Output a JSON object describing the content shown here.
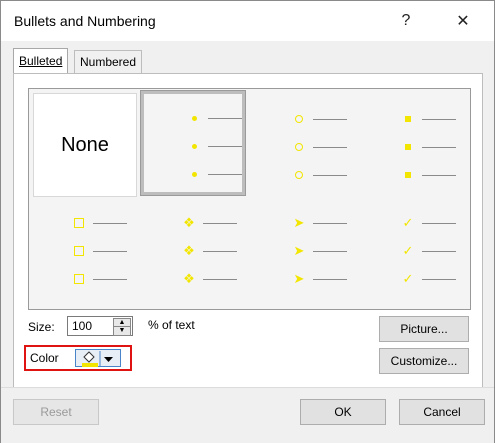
{
  "window": {
    "title": "Bullets and Numbering",
    "help_glyph": "?",
    "close_glyph": "✕"
  },
  "tabs": [
    {
      "label": "Bulleted",
      "active": true
    },
    {
      "label": "Numbered",
      "active": false
    }
  ],
  "gallery": {
    "none_label": "None",
    "styles": [
      "none",
      "dot",
      "circle",
      "square",
      "hollow-square",
      "diamond-cluster",
      "arrowhead",
      "checkmark"
    ],
    "selected_style": "dot",
    "bullet_color": "#f2e600"
  },
  "size": {
    "label": "Size:",
    "value": "100",
    "unit_label": "% of text"
  },
  "color": {
    "label": "Color",
    "highlight_color": "#e01313"
  },
  "buttons": {
    "picture": "Picture...",
    "customize": "Customize...",
    "reset": "Reset",
    "ok": "OK",
    "cancel": "Cancel"
  }
}
